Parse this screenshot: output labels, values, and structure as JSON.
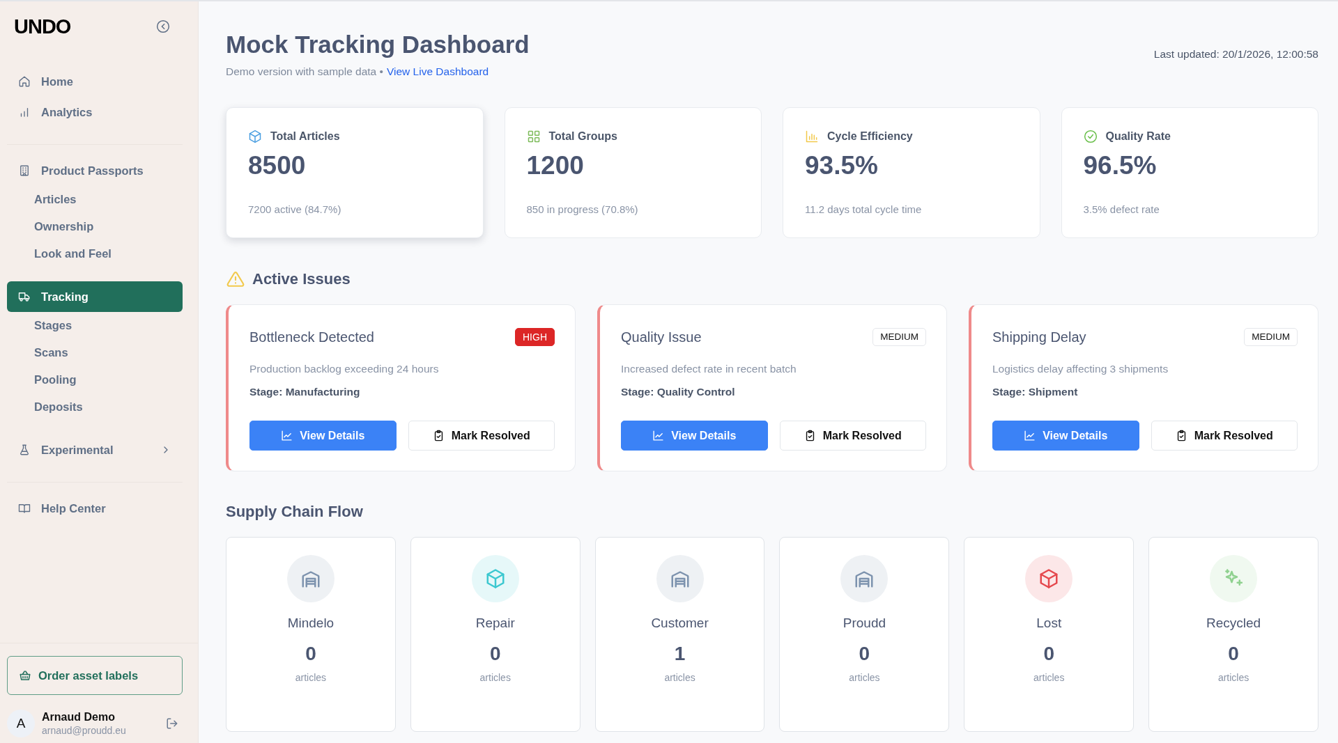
{
  "sidebar": {
    "logo": "UNDO",
    "sections": [
      {
        "items": [
          {
            "label": "Home",
            "selected": false
          },
          {
            "label": "Analytics",
            "selected": false
          }
        ]
      },
      {
        "items": [
          {
            "label": "Product Passports",
            "selected": false,
            "expanded": true,
            "children": [
              {
                "label": "Articles",
                "selected": false
              },
              {
                "label": "Ownership",
                "selected": false
              },
              {
                "label": "Look and Feel",
                "selected": false
              }
            ]
          },
          {
            "label": "Tracking",
            "selected": true,
            "expanded": true,
            "children": [
              {
                "label": "Stages",
                "selected": false
              },
              {
                "label": "Scans",
                "selected": false
              },
              {
                "label": "Pooling",
                "selected": false
              },
              {
                "label": "Deposits",
                "selected": false
              }
            ]
          },
          {
            "label": "Experimental",
            "selected": false,
            "expanded": false
          }
        ]
      },
      {
        "items": [
          {
            "label": "Help Center",
            "selected": false
          }
        ]
      }
    ],
    "order_button": "Order asset labels",
    "user": {
      "initial": "A",
      "name": "Arnaud Demo",
      "email": "arnaud@proudd.eu"
    }
  },
  "header": {
    "title": "Mock Tracking Dashboard",
    "subtitle": "Demo version with sample data •",
    "link": "View Live Dashboard",
    "last_updated": "Last updated: 20/1/2026, 12:00:58"
  },
  "stats": [
    {
      "label": "Total Articles",
      "value": "8500",
      "note": "7200 active (84.7%)",
      "color": "#4b9fe1",
      "hovered": true
    },
    {
      "label": "Total Groups",
      "value": "1200",
      "note": "850 in progress (70.8%)",
      "color": "#7dbb5a",
      "hovered": false
    },
    {
      "label": "Cycle Efficiency",
      "value": "93.5%",
      "note": "11.2 days total cycle time",
      "color": "#f2c94c",
      "hovered": false
    },
    {
      "label": "Quality Rate",
      "value": "96.5%",
      "note": "3.5% defect rate",
      "color": "#6abf4b",
      "hovered": false
    }
  ],
  "active_issues": {
    "title": "Active Issues",
    "issues": [
      {
        "title": "Bottleneck Detected",
        "badge": "HIGH",
        "kind": "high",
        "description": "Production backlog exceeding 24 hours",
        "stage": "Stage: Manufacturing",
        "buttons": [
          "View Details",
          "Mark Resolved"
        ]
      },
      {
        "title": "Quality Issue",
        "badge": "MEDIUM",
        "kind": "medium",
        "description": "Increased defect rate in recent batch",
        "stage": "Stage: Quality Control",
        "buttons": [
          "View Details",
          "Mark Resolved"
        ]
      },
      {
        "title": "Shipping Delay",
        "badge": "MEDIUM",
        "kind": "medium",
        "description": "Logistics delay affecting 3 shipments",
        "stage": "Stage: Shipment",
        "buttons": [
          "View Details",
          "Mark Resolved"
        ]
      }
    ]
  },
  "supply_chain": {
    "title": "Supply Chain Flow",
    "stages": [
      {
        "name": "Mindelo",
        "count": "0",
        "unit": "articles",
        "color": "#7d93ae"
      },
      {
        "name": "Repair",
        "count": "0",
        "unit": "articles",
        "color": "#3cc8d0"
      },
      {
        "name": "Customer",
        "count": "1",
        "unit": "articles",
        "color": "#7d93ae"
      },
      {
        "name": "Proudd",
        "count": "0",
        "unit": "articles",
        "color": "#7d93ae"
      },
      {
        "name": "Lost",
        "count": "0",
        "unit": "articles",
        "color": "#e5484d"
      },
      {
        "name": "Recycled",
        "count": "0",
        "unit": "articles",
        "color": "#8fd18f"
      }
    ]
  }
}
